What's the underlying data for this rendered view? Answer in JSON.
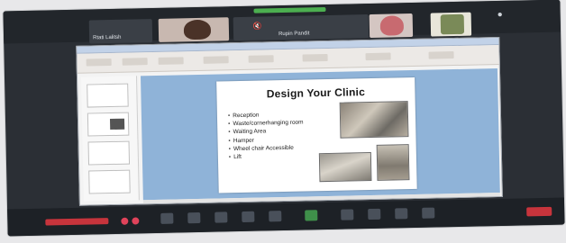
{
  "meeting": {
    "participants": [
      {
        "name": "Rtati Lalitsh"
      },
      {
        "name": ""
      },
      {
        "name": "Rupin Pandit"
      },
      {
        "name": ""
      },
      {
        "name": ""
      }
    ]
  },
  "slide": {
    "title": "Design Your Clinic",
    "bullets": [
      "Reception",
      "Waste/cornerhanging room",
      "Waiting Area",
      "Hamper",
      "Wheel chair Accessible",
      "Lift"
    ]
  },
  "colors": {
    "accent_green": "#4caf50",
    "end_red": "#c7343c",
    "slide_bg": "#8fb3d8"
  },
  "icons": [
    "mic-icon",
    "video-icon",
    "share-icon",
    "chat-icon",
    "participants-icon",
    "more-icon",
    "end-call-icon"
  ]
}
